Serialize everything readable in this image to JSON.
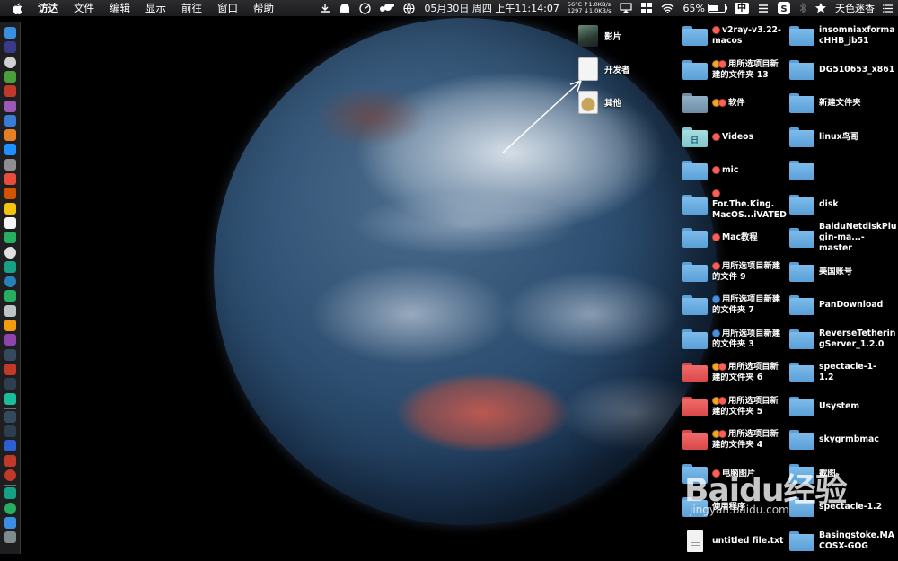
{
  "menubar": {
    "app_name": "访达",
    "menus": [
      "文件",
      "编辑",
      "显示",
      "前往",
      "窗口",
      "帮助"
    ],
    "status": {
      "temp": "56°C",
      "fan": "1297",
      "up": "↑1.0KB/s",
      "down": "↓1.0KB/s",
      "date": "05月30日 周四 上午11:14:07",
      "battery": "65%",
      "battery_level": 0.65,
      "input_method": "中",
      "user": "天色迷香"
    }
  },
  "middle_items": [
    {
      "label": "影片",
      "icon": "movie-thumbnail"
    },
    {
      "label": "开发者",
      "icon": "developer-document"
    },
    {
      "label": "其他",
      "icon": "other-document"
    }
  ],
  "desktop_col1": [
    {
      "label": "v2ray-v3.22-\nmacos",
      "color": "blue",
      "tags": [
        "red"
      ]
    },
    {
      "label": "用所选项目新\n建的文件夹 13",
      "color": "blue",
      "tags": [
        "orange",
        "red"
      ]
    },
    {
      "label": "软件",
      "color": "gray",
      "tags": [
        "orange",
        "red"
      ]
    },
    {
      "label": "Videos",
      "color": "teal",
      "tags": [
        "red"
      ]
    },
    {
      "label": "mic",
      "color": "blue",
      "tags": [
        "red"
      ]
    },
    {
      "label": "For.The.King.\nMacOS...iVATED",
      "color": "blue",
      "tags": [
        "red"
      ]
    },
    {
      "label": "Mac教程",
      "color": "blue",
      "tags": [
        "red"
      ]
    },
    {
      "label": "用所选项目新建\n的文件 9",
      "color": "blue",
      "tags": [
        "red"
      ]
    },
    {
      "label": "用所选项目新建\n的文件夹 7",
      "color": "blue",
      "tags": [
        "blue"
      ]
    },
    {
      "label": "用所选项目新建\n的文件夹 3",
      "color": "blue",
      "tags": [
        "blue"
      ]
    },
    {
      "label": "用所选项目新\n建的文件夹 6",
      "color": "red",
      "tags": [
        "orange",
        "red"
      ]
    },
    {
      "label": "用所选项目新\n建的文件夹 5",
      "color": "red",
      "tags": [
        "orange",
        "red"
      ]
    },
    {
      "label": "用所选项目新\n建的文件夹 4",
      "color": "red",
      "tags": [
        "orange",
        "red"
      ]
    },
    {
      "label": "电脑图片",
      "color": "blue",
      "tags": [
        "red"
      ]
    },
    {
      "label": "使用程序",
      "color": "blue",
      "tags": []
    },
    {
      "label": "untitled file.txt",
      "color": "doc",
      "tags": []
    }
  ],
  "desktop_col2": [
    {
      "label": "insomniaxforma\ncHHB_jb51",
      "color": "blue"
    },
    {
      "label": "DG510653_x861",
      "color": "blue"
    },
    {
      "label": "新建文件夹",
      "color": "blue"
    },
    {
      "label": "linux鸟哥",
      "color": "blue"
    },
    {
      "label": "",
      "color": "blue"
    },
    {
      "label": "disk",
      "color": "blue"
    },
    {
      "label": "BaiduNetdiskPlu\ngin-ma...-master",
      "color": "blue"
    },
    {
      "label": "美国账号",
      "color": "blue"
    },
    {
      "label": "PanDownload",
      "color": "blue"
    },
    {
      "label": "ReverseTetherin\ngServer_1.2.0",
      "color": "blue"
    },
    {
      "label": "spectacle-1-1.2",
      "color": "blue"
    },
    {
      "label": "Usystem",
      "color": "blue"
    },
    {
      "label": "skygrmbmac",
      "color": "blue"
    },
    {
      "label": "截图",
      "color": "blue"
    },
    {
      "label": "spectacle-1.2",
      "color": "blue"
    },
    {
      "label": "Basingstoke.MA\nCOSX-GOG",
      "color": "blue"
    }
  ],
  "watermark": {
    "logo": "Baidu经验",
    "url": "jingyan.baidu.com"
  }
}
